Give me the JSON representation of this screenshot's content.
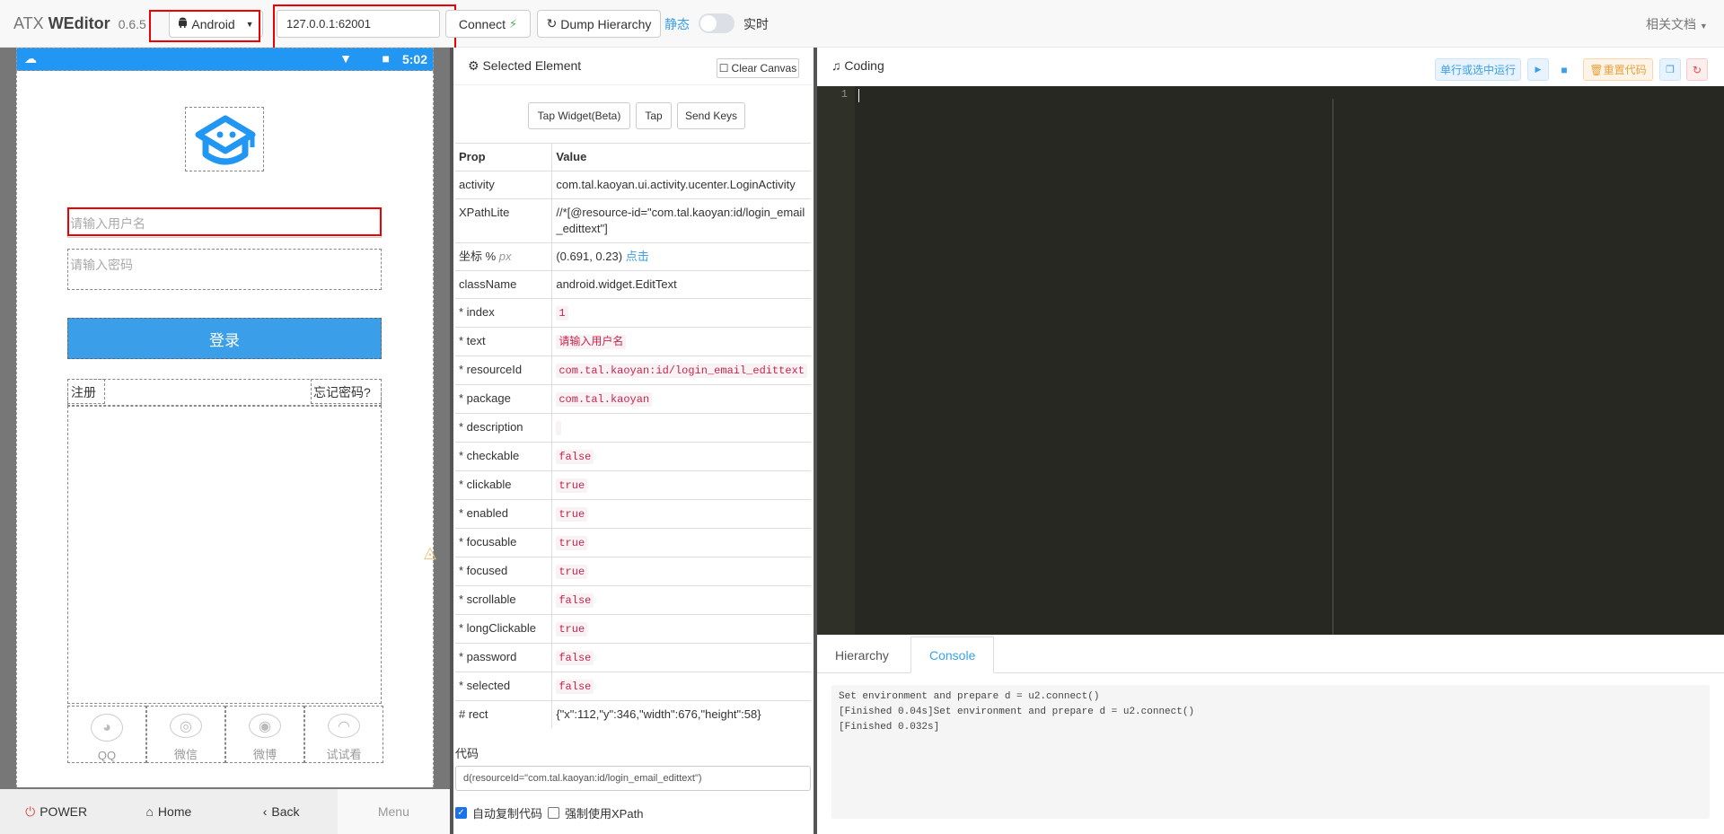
{
  "navbar": {
    "brand_prefix": "ATX",
    "brand_name": "WEditor",
    "version": "0.6.5",
    "platform": "Android",
    "address": "127.0.0.1:62001",
    "connect_label": "Connect",
    "dump_label": "Dump Hierarchy",
    "mode_static": "静态",
    "mode_live": "实时",
    "docs_label": "相关文档"
  },
  "device": {
    "status_time": "5:02",
    "username_placeholder": "请输入用户名",
    "password_placeholder": "请输入密码",
    "login_label": "登录",
    "register_label": "注册",
    "forgot_label": "忘记密码?",
    "social": [
      {
        "label": "QQ",
        "icon": "qq-icon"
      },
      {
        "label": "微信",
        "icon": "wechat-icon"
      },
      {
        "label": "微博",
        "icon": "weibo-icon"
      },
      {
        "label": "试试看",
        "icon": "ghost-icon"
      }
    ],
    "buttons": {
      "power": "POWER",
      "home": "Home",
      "back": "Back",
      "menu": "Menu"
    }
  },
  "inspector": {
    "title": "Selected Element",
    "clear_label": "Clear Canvas",
    "tap_widget_label": "Tap Widget(Beta)",
    "tap_label": "Tap",
    "send_keys_label": "Send Keys",
    "header_prop": "Prop",
    "header_value": "Value",
    "coord_prop": "坐标 %",
    "coord_unit": "px",
    "coord_value": "(0.691, 0.23)",
    "coord_click": "点击",
    "props": [
      {
        "k": "activity",
        "v": "com.tal.kaoyan.ui.activity.ucenter.LoginActivity",
        "code": false
      },
      {
        "k": "XPathLite",
        "v": "//*[@resource-id=\"com.tal.kaoyan:id/login_email_edittext\"]",
        "code": false
      },
      {
        "k": "className",
        "v": "android.widget.EditText",
        "code": false
      },
      {
        "k": "* index",
        "v": "1",
        "code": true
      },
      {
        "k": "* text",
        "v": "请输入用户名",
        "code": true
      },
      {
        "k": "* resourceId",
        "v": "com.tal.kaoyan:id/login_email_edittext",
        "code": true
      },
      {
        "k": "* package",
        "v": "com.tal.kaoyan",
        "code": true
      },
      {
        "k": "* description",
        "v": "",
        "code": true
      },
      {
        "k": "* checkable",
        "v": "false",
        "code": true
      },
      {
        "k": "* clickable",
        "v": "true",
        "code": true
      },
      {
        "k": "* enabled",
        "v": "true",
        "code": true
      },
      {
        "k": "* focusable",
        "v": "true",
        "code": true
      },
      {
        "k": "* focused",
        "v": "true",
        "code": true
      },
      {
        "k": "* scrollable",
        "v": "false",
        "code": true
      },
      {
        "k": "* longClickable",
        "v": "true",
        "code": true
      },
      {
        "k": "* password",
        "v": "false",
        "code": true
      },
      {
        "k": "* selected",
        "v": "false",
        "code": true
      },
      {
        "k": "# rect",
        "v": "{\"x\":112,\"y\":346,\"width\":676,\"height\":58}",
        "code": false
      }
    ],
    "code_label": "代码",
    "code_value": "d(resourceId=\"com.tal.kaoyan:id/login_email_edittext\")",
    "auto_copy_label": "自动复制代码",
    "force_xpath_label": "强制使用XPath"
  },
  "coding": {
    "title": "Coding",
    "run_label": "单行或选中运行",
    "reset_label": "重置代码",
    "line_number": "1",
    "tabs": [
      "Hierarchy",
      "Console"
    ],
    "active_tab": "Console",
    "console_lines": [
      "Set environment and prepare d = u2.connect()",
      "[Finished 0.04s]Set environment and prepare d = u2.connect()",
      "[Finished 0.032s]"
    ]
  },
  "colors": {
    "accent": "#3a9fe8",
    "highlight": "#ee0000",
    "editor_bg": "#272822"
  }
}
